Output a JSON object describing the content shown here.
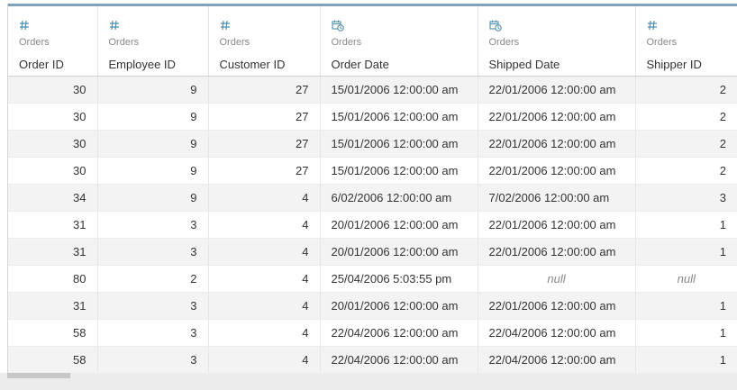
{
  "columns": [
    {
      "source": "Orders",
      "title": "Order ID",
      "icon": "number-icon",
      "kind": "num"
    },
    {
      "source": "Orders",
      "title": "Employee ID",
      "icon": "number-icon",
      "kind": "num"
    },
    {
      "source": "Orders",
      "title": "Customer ID",
      "icon": "number-icon",
      "kind": "num"
    },
    {
      "source": "Orders",
      "title": "Order Date",
      "icon": "datetime-icon",
      "kind": "date"
    },
    {
      "source": "Orders",
      "title": "Shipped Date",
      "icon": "datetime-icon",
      "kind": "date"
    },
    {
      "source": "Orders",
      "title": "Shipper ID",
      "icon": "number-icon",
      "kind": "num"
    }
  ],
  "rows": [
    [
      "30",
      "9",
      "27",
      "15/01/2006 12:00:00 am",
      "22/01/2006 12:00:00 am",
      "2"
    ],
    [
      "30",
      "9",
      "27",
      "15/01/2006 12:00:00 am",
      "22/01/2006 12:00:00 am",
      "2"
    ],
    [
      "30",
      "9",
      "27",
      "15/01/2006 12:00:00 am",
      "22/01/2006 12:00:00 am",
      "2"
    ],
    [
      "30",
      "9",
      "27",
      "15/01/2006 12:00:00 am",
      "22/01/2006 12:00:00 am",
      "2"
    ],
    [
      "34",
      "9",
      "4",
      "6/02/2006 12:00:00 am",
      "7/02/2006 12:00:00 am",
      "3"
    ],
    [
      "31",
      "3",
      "4",
      "20/01/2006 12:00:00 am",
      "22/01/2006 12:00:00 am",
      "1"
    ],
    [
      "31",
      "3",
      "4",
      "20/01/2006 12:00:00 am",
      "22/01/2006 12:00:00 am",
      "1"
    ],
    [
      "80",
      "2",
      "4",
      "25/04/2006 5:03:55 pm",
      "null",
      "null"
    ],
    [
      "31",
      "3",
      "4",
      "20/01/2006 12:00:00 am",
      "22/01/2006 12:00:00 am",
      "1"
    ],
    [
      "58",
      "3",
      "4",
      "22/04/2006 12:00:00 am",
      "22/04/2006 12:00:00 am",
      "1"
    ],
    [
      "58",
      "3",
      "4",
      "22/04/2006 12:00:00 am",
      "22/04/2006 12:00:00 am",
      "1"
    ]
  ],
  "null_text": "null",
  "colors": {
    "accent": "#7fa3bd",
    "icon": "#4e8faa",
    "row_alt": "#f3f3f3",
    "null_text": "#888888"
  }
}
